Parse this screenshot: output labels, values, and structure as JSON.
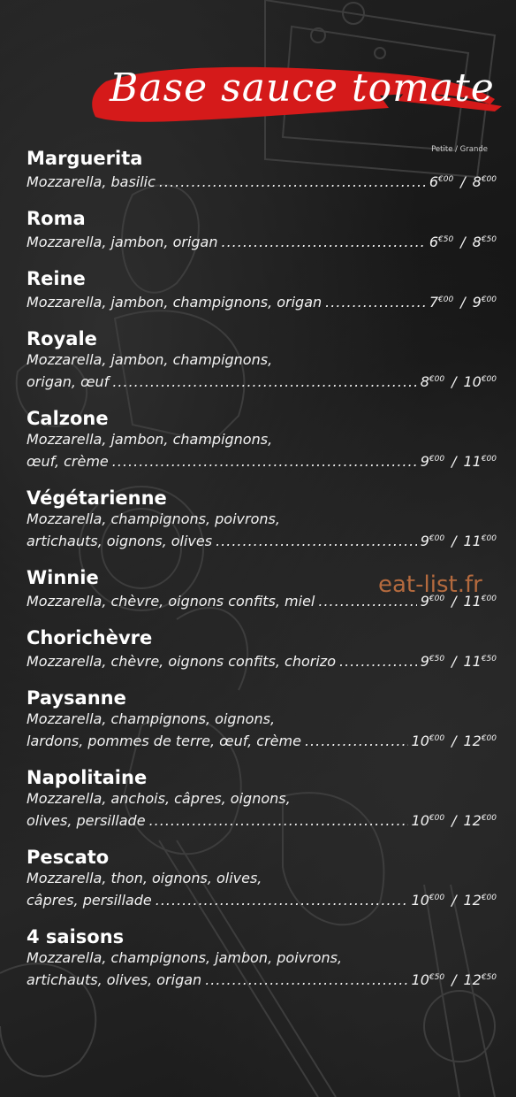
{
  "section": {
    "title": "Base sauce tomate",
    "size_header": "Petite / Grande",
    "accent_color": "#d51a1a"
  },
  "watermark": "eat-list.fr",
  "items": [
    {
      "name": "Marguerita",
      "desc_lines": [],
      "last_line": "Mozzarella, basilic",
      "small": [
        "6",
        "€00"
      ],
      "large": [
        "8",
        "€00"
      ]
    },
    {
      "name": "Roma",
      "desc_lines": [],
      "last_line": "Mozzarella, jambon, origan",
      "small": [
        "6",
        "€50"
      ],
      "large": [
        "8",
        "€50"
      ]
    },
    {
      "name": "Reine",
      "desc_lines": [],
      "last_line": "Mozzarella, jambon, champignons, origan",
      "small": [
        "7",
        "€00"
      ],
      "large": [
        "9",
        "€00"
      ]
    },
    {
      "name": "Royale",
      "desc_lines": [
        "Mozzarella, jambon, champignons,"
      ],
      "last_line": "origan, œuf",
      "small": [
        "8",
        "€00"
      ],
      "large": [
        "10",
        "€00"
      ]
    },
    {
      "name": "Calzone",
      "desc_lines": [
        "Mozzarella, jambon, champignons,"
      ],
      "last_line": "œuf, crème",
      "small": [
        "9",
        "€00"
      ],
      "large": [
        "11",
        "€00"
      ]
    },
    {
      "name": "Végétarienne",
      "desc_lines": [
        "Mozzarella, champignons, poivrons,"
      ],
      "last_line": "artichauts, oignons, olives",
      "small": [
        "9",
        "€00"
      ],
      "large": [
        "11",
        "€00"
      ]
    },
    {
      "name": "Winnie",
      "desc_lines": [],
      "last_line": "Mozzarella, chèvre, oignons confits, miel",
      "small": [
        "9",
        "€00"
      ],
      "large": [
        "11",
        "€00"
      ]
    },
    {
      "name": "Chorichèvre",
      "desc_lines": [],
      "last_line": "Mozzarella, chèvre, oignons confits, chorizo",
      "small": [
        "9",
        "€50"
      ],
      "large": [
        "11",
        "€50"
      ]
    },
    {
      "name": "Paysanne",
      "desc_lines": [
        "Mozzarella, champignons, oignons,"
      ],
      "last_line": "lardons, pommes de terre, œuf, crème",
      "small": [
        "10",
        "€00"
      ],
      "large": [
        "12",
        "€00"
      ]
    },
    {
      "name": "Napolitaine",
      "desc_lines": [
        "Mozzarella, anchois, câpres, oignons,"
      ],
      "last_line": "olives, persillade",
      "small": [
        "10",
        "€00"
      ],
      "large": [
        "12",
        "€00"
      ]
    },
    {
      "name": "Pescato",
      "desc_lines": [
        "Mozzarella, thon, oignons, olives,"
      ],
      "last_line": "câpres, persillade",
      "small": [
        "10",
        "€00"
      ],
      "large": [
        "12",
        "€00"
      ]
    },
    {
      "name": "4 saisons",
      "desc_lines": [
        "Mozzarella, champignons, jambon, poivrons,"
      ],
      "last_line": "artichauts, olives, origan",
      "small": [
        "10",
        "€50"
      ],
      "large": [
        "12",
        "€50"
      ]
    }
  ]
}
